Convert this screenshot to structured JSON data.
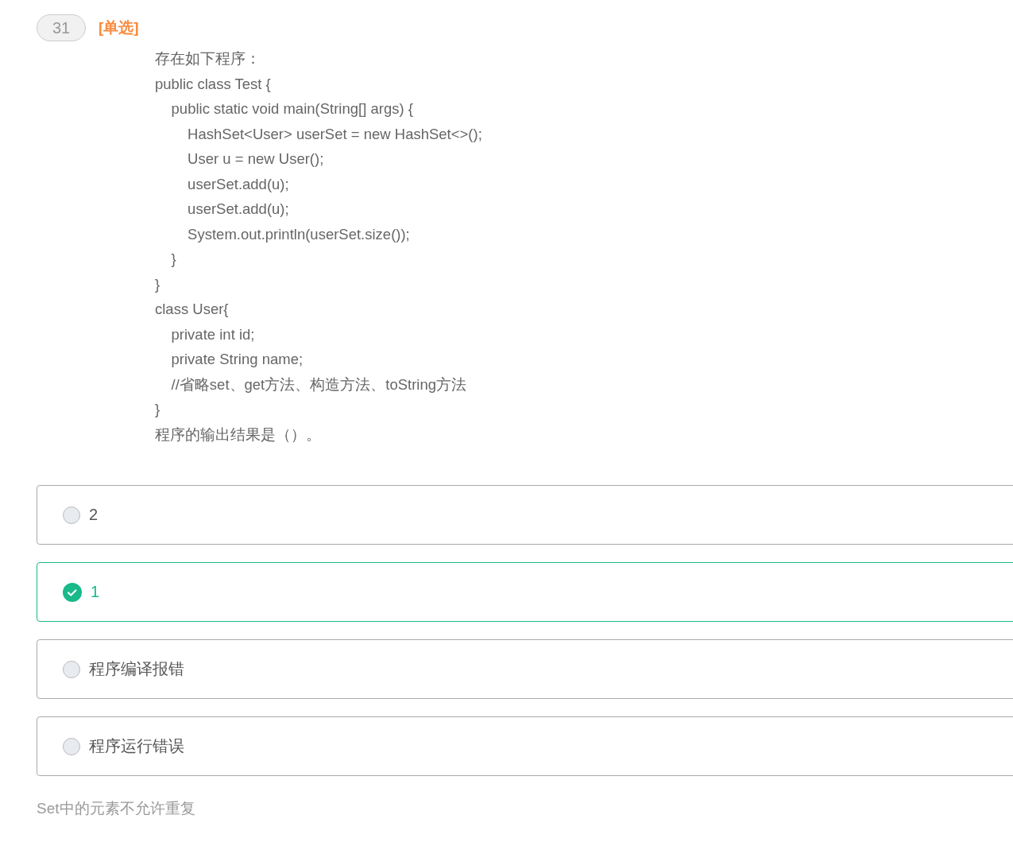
{
  "question": {
    "number": "31",
    "type_tag": "[单选]",
    "lines": [
      "存在如下程序：",
      "public class Test {",
      "    public static void main(String[] args) {",
      "        HashSet<User> userSet = new HashSet<>();",
      "        User u = new User();",
      "        userSet.add(u);",
      "        userSet.add(u);",
      "        System.out.println(userSet.size());",
      "    }",
      "}",
      "class User{",
      "    private int id;",
      "    private String name;",
      "    //省略set、get方法、构造方法、toString方法",
      "}",
      "程序的输出结果是（）。"
    ]
  },
  "options": [
    {
      "label": "2",
      "selected": false
    },
    {
      "label": "1",
      "selected": true
    },
    {
      "label": "程序编译报错",
      "selected": false
    },
    {
      "label": "程序运行错误",
      "selected": false
    }
  ],
  "explanation": "Set中的元素不允许重复"
}
